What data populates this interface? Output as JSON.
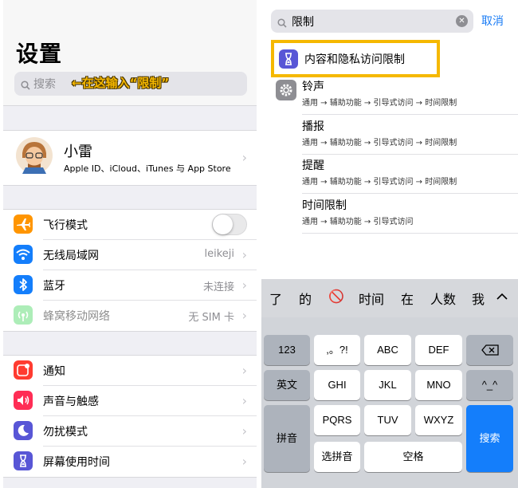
{
  "left": {
    "title": "设置",
    "search_placeholder": "搜索",
    "annotation": "←在这输入“限制”",
    "profile": {
      "name": "小雷",
      "subtitle": "Apple ID、iCloud、iTunes 与 App Store"
    },
    "group1": [
      {
        "label": "飞行模式",
        "icon": "airplane-icon",
        "color": "#ff9500",
        "toggle": false
      },
      {
        "label": "无线局域网",
        "icon": "wifi-icon",
        "color": "#147efb",
        "value": "leikeji"
      },
      {
        "label": "蓝牙",
        "icon": "bluetooth-icon",
        "color": "#147efb",
        "value": "未连接"
      },
      {
        "label": "蜂窝移动网络",
        "icon": "cellular-icon",
        "color": "#4cd964",
        "value": "无 SIM 卡",
        "disabled": true
      }
    ],
    "group2": [
      {
        "label": "通知",
        "icon": "notifications-icon",
        "color": "#ff3b30"
      },
      {
        "label": "声音与触感",
        "icon": "sound-icon",
        "color": "#ff2d55"
      },
      {
        "label": "勿扰模式",
        "icon": "moon-icon",
        "color": "#5856d6"
      },
      {
        "label": "屏幕使用时间",
        "icon": "hourglass-icon",
        "color": "#5856d6"
      }
    ]
  },
  "right": {
    "search_text": "限制",
    "cancel_label": "取消",
    "results": [
      {
        "title": "内容和隐私访问限制",
        "icon": "hourglass-icon",
        "highlighted": true
      },
      {
        "title": "铃声",
        "path": "通用 → 辅助功能 → 引导式访问 → 时间限制",
        "icon": "gear-icon"
      },
      {
        "title": "播报",
        "path": "通用 → 辅助功能 → 引导式访问 → 时间限制"
      },
      {
        "title": "提醒",
        "path": "通用 → 辅助功能 → 引导式访问 → 时间限制"
      },
      {
        "title": "时间限制",
        "path": "通用 → 辅助功能 → 引导式访问"
      }
    ],
    "keyboard": {
      "candidates": [
        "了",
        "的",
        "🚫",
        "时间",
        "在",
        "人数",
        "我"
      ],
      "keys": {
        "k123": "123",
        "punct": ",。?!",
        "abc": "ABC",
        "def": "DEF",
        "english": "英文",
        "ghi": "GHI",
        "jkl": "JKL",
        "mno": "MNO",
        "kaomoji": "^_^",
        "pinyin": "拼音",
        "pqrs": "PQRS",
        "tuv": "TUV",
        "wxyz": "WXYZ",
        "search": "搜索",
        "select_pinyin": "选拼音",
        "space": "空格"
      }
    }
  }
}
